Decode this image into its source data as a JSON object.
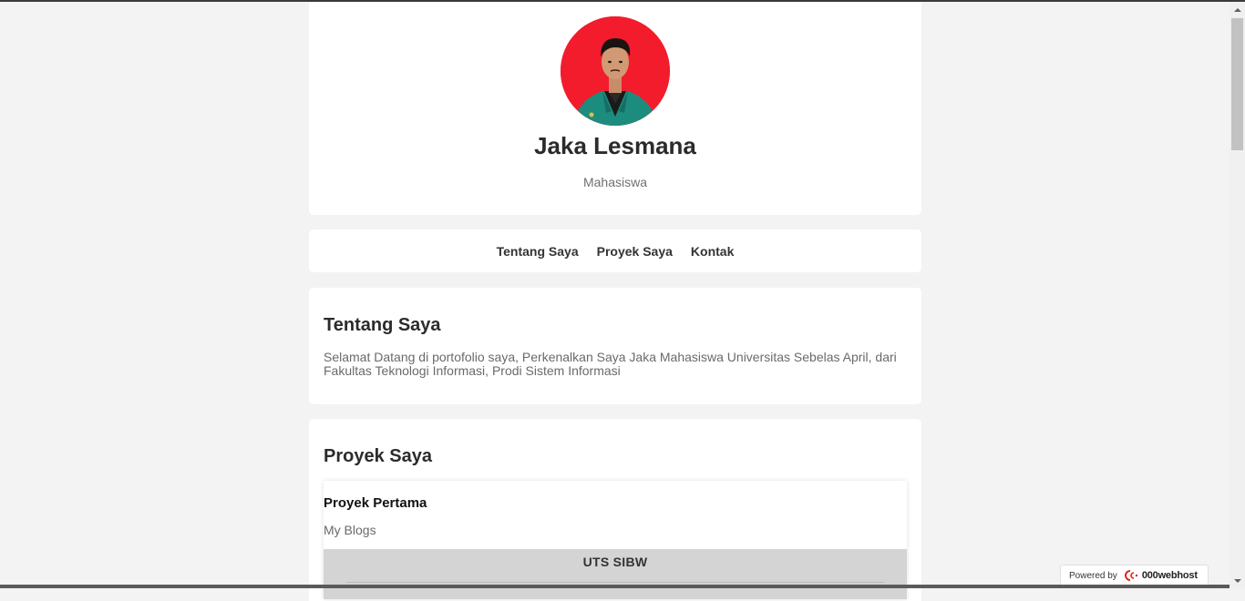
{
  "profile": {
    "name": "Jaka Lesmana",
    "role": "Mahasiswa"
  },
  "nav": {
    "items": [
      "Tentang Saya",
      "Proyek Saya",
      "Kontak"
    ]
  },
  "about": {
    "title": "Tentang Saya",
    "text": "Selamat Datang di portofolio saya, Perkenalkan Saya Jaka Mahasiswa Universitas Sebelas April, dari Fakultas Teknologi Informasi, Prodi Sistem Informasi"
  },
  "projects": {
    "title": "Proyek Saya",
    "items": [
      {
        "title": "Proyek Pertama",
        "description": "My Blogs",
        "preview_title": "UTS SIBW"
      }
    ]
  },
  "badge": {
    "prefix": "Powered by",
    "brand": "000webhost"
  },
  "colors": {
    "page_bg": "#f3f3f3",
    "card_bg": "#ffffff",
    "avatar_bg": "#f21c2c",
    "jacket": "#1c8c7e"
  }
}
